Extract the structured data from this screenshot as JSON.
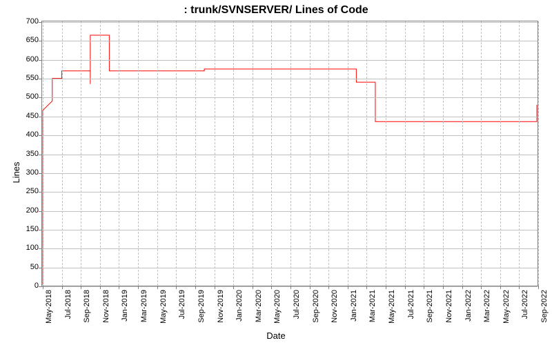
{
  "title_prefix": " : ",
  "title_main": "trunk/SVNSERVER/ Lines of Code",
  "xlabel": "Date",
  "ylabel": "Lines",
  "chart_data": {
    "type": "line",
    "title": "trunk/SVNSERVER/ Lines of Code",
    "xlabel": "Date",
    "ylabel": "Lines",
    "ylim": [
      0,
      700
    ],
    "x_ticks": [
      "May-2018",
      "Jul-2018",
      "Sep-2018",
      "Nov-2018",
      "Jan-2019",
      "Mar-2019",
      "May-2019",
      "Jul-2019",
      "Sep-2019",
      "Nov-2019",
      "Jan-2020",
      "Mar-2020",
      "May-2020",
      "Jul-2020",
      "Sep-2020",
      "Nov-2020",
      "Jan-2021",
      "Mar-2021",
      "May-2021",
      "Jul-2021",
      "Sep-2021",
      "Nov-2021",
      "Jan-2022",
      "Mar-2022",
      "May-2022",
      "Jul-2022",
      "Sep-2022"
    ],
    "y_ticks": [
      0,
      50,
      100,
      150,
      200,
      250,
      300,
      350,
      400,
      450,
      500,
      550,
      600,
      650,
      700
    ],
    "series": [
      {
        "name": "Lines of Code",
        "color": "#ff0000",
        "points": [
          {
            "x": "May-2018",
            "y": 0
          },
          {
            "x": "May-2018",
            "y": 60
          },
          {
            "x": "May-2018",
            "y": 0
          },
          {
            "x": "May-2018",
            "y": 215
          },
          {
            "x": "May-2018",
            "y": 425
          },
          {
            "x": "May-2018",
            "y": 465
          },
          {
            "x": "Jun-2018",
            "y": 490
          },
          {
            "x": "Jun-2018",
            "y": 550
          },
          {
            "x": "Jul-2018",
            "y": 550
          },
          {
            "x": "Jul-2018",
            "y": 570
          },
          {
            "x": "Oct-2018",
            "y": 570
          },
          {
            "x": "Oct-2018",
            "y": 535
          },
          {
            "x": "Oct-2018",
            "y": 665
          },
          {
            "x": "Dec-2018",
            "y": 665
          },
          {
            "x": "Dec-2018",
            "y": 570
          },
          {
            "x": "Oct-2019",
            "y": 570
          },
          {
            "x": "Oct-2019",
            "y": 575
          },
          {
            "x": "Feb-2021",
            "y": 575
          },
          {
            "x": "Feb-2021",
            "y": 540
          },
          {
            "x": "Apr-2021",
            "y": 540
          },
          {
            "x": "Apr-2021",
            "y": 435
          },
          {
            "x": "Sep-2022",
            "y": 435
          },
          {
            "x": "Sep-2022",
            "y": 480
          }
        ]
      }
    ]
  }
}
